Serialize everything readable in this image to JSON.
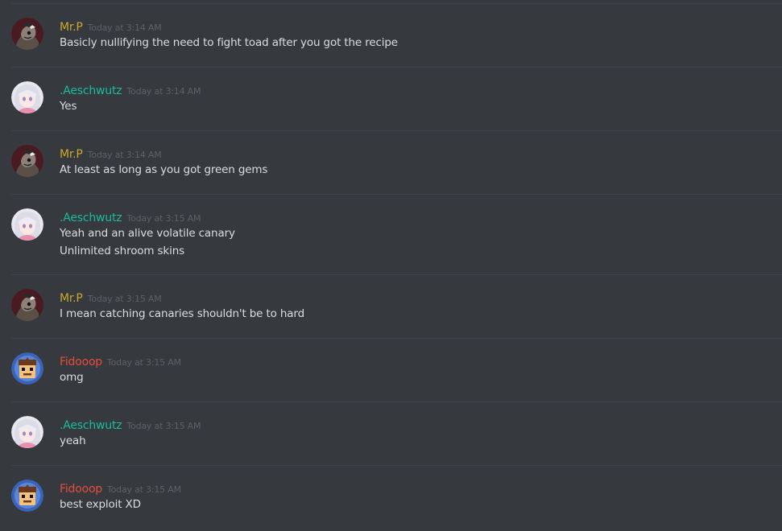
{
  "colors": {
    "background": "#36393e",
    "divider": "#3f4248",
    "text": "#dcddde",
    "timestamp": "#5d6066"
  },
  "messages": [
    {
      "username": "Mr.P",
      "name_color": "#c9a82e",
      "avatar": "mrp-avatar",
      "timestamp": "Today at 3:14 AM",
      "lines": [
        "Basicly nullifying the need to fight toad after you got the recipe"
      ]
    },
    {
      "username": ".Aeschwutz",
      "name_color": "#1abc9c",
      "avatar": "aeschwutz-avatar",
      "timestamp": "Today at 3:14 AM",
      "lines": [
        "Yes"
      ]
    },
    {
      "username": "Mr.P",
      "name_color": "#c9a82e",
      "avatar": "mrp-avatar",
      "timestamp": "Today at 3:14 AM",
      "lines": [
        "At least as long as you got green gems"
      ]
    },
    {
      "username": ".Aeschwutz",
      "name_color": "#1abc9c",
      "avatar": "aeschwutz-avatar",
      "timestamp": "Today at 3:15 AM",
      "lines": [
        "Yeah and an alive volatile canary",
        "Unlimited shroom skins"
      ]
    },
    {
      "username": "Mr.P",
      "name_color": "#c9a82e",
      "avatar": "mrp-avatar",
      "timestamp": "Today at 3:15 AM",
      "lines": [
        "I mean catching canaries shouldn't be to hard"
      ]
    },
    {
      "username": "Fidooop",
      "name_color": "#e74c3c",
      "avatar": "fidooop-avatar",
      "timestamp": "Today at 3:15 AM",
      "lines": [
        "omg"
      ]
    },
    {
      "username": ".Aeschwutz",
      "name_color": "#1abc9c",
      "avatar": "aeschwutz-avatar",
      "timestamp": "Today at 3:15 AM",
      "lines": [
        "yeah"
      ]
    },
    {
      "username": "Fidooop",
      "name_color": "#e74c3c",
      "avatar": "fidooop-avatar",
      "timestamp": "Today at 3:15 AM",
      "lines": [
        "best exploit XD"
      ]
    }
  ]
}
